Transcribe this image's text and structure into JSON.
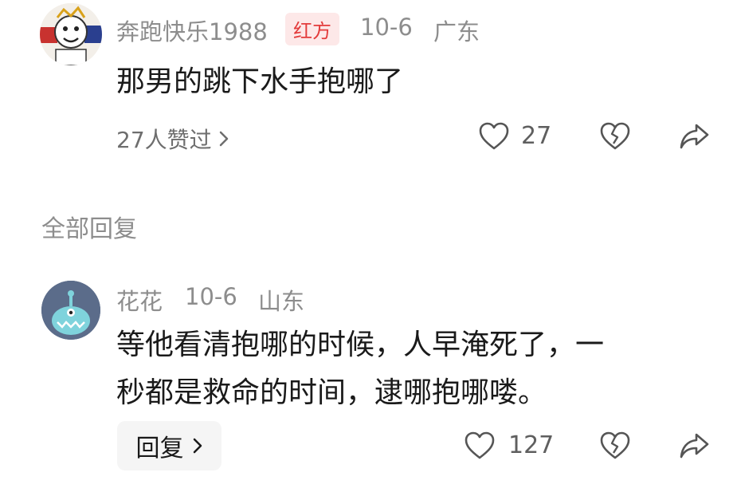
{
  "comment": {
    "username": "奔跑快乐1988",
    "badge": "红方",
    "date": "10-6",
    "location": "广东",
    "text": "那男的跳下水手抱哪了",
    "likers_label": "27人赞过",
    "like_count": "27"
  },
  "section_title": "全部回复",
  "reply": {
    "username": "花花",
    "date": "10-6",
    "location": "山东",
    "text_line1": "等他看清抱哪的时候，人早淹死了，一",
    "text_line2": "秒都是救命的时间，逮哪抱哪喽。",
    "reply_button_label": "回复",
    "like_count": "127"
  },
  "colors": {
    "badge_bg": "#fde8e8",
    "badge_text": "#e33b3b",
    "reply_avatar_bg": "#5b6c8a"
  },
  "icons": [
    "heart-icon",
    "broken-heart-icon",
    "share-arrow-icon",
    "chevron-right-icon"
  ]
}
